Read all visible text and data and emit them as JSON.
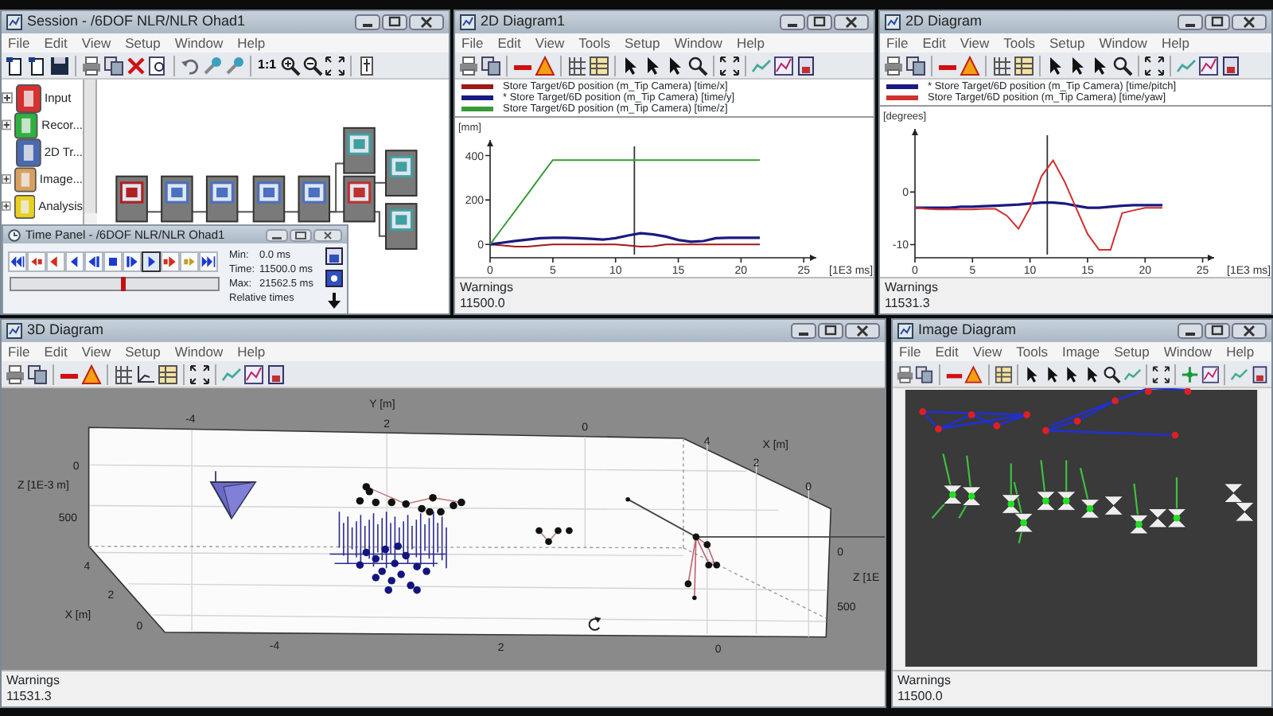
{
  "session_window": {
    "title": "Session - /6DOF NLR/NLR Ohad1",
    "menu": [
      "File",
      "Edit",
      "View",
      "Setup",
      "Window",
      "Help"
    ],
    "zoom_label": "1:1",
    "tree": [
      {
        "label": "Input",
        "kind": "group",
        "expanded": false
      },
      {
        "label": "Recor...",
        "kind": "group",
        "expanded": false
      },
      {
        "label": "2D Tr...",
        "kind": "leaf"
      },
      {
        "label": "Image...",
        "kind": "group",
        "expanded": false
      },
      {
        "label": "Analysis",
        "kind": "group",
        "expanded": false
      }
    ],
    "time_panel": {
      "title": "Time Panel - /6DOF NLR/NLR Ohad1",
      "play_active": true,
      "min_label": "Min:",
      "min": "0.0 ms",
      "time_label": "Time:",
      "time": "11500.0 ms",
      "max_label": "Max:",
      "max": "21562.5 ms",
      "mode": "Relative times",
      "level": 0.53
    }
  },
  "diagram_1": {
    "title": "2D Diagram1",
    "menu": [
      "File",
      "Edit",
      "View",
      "Tools",
      "Setup",
      "Window",
      "Help"
    ],
    "chart_data": {
      "type": "line",
      "xlabel": "[1E3 ms]",
      "ylabel": "[mm]",
      "x": [
        0,
        1,
        2,
        3,
        4,
        5,
        6,
        7,
        8,
        9,
        10,
        11,
        12,
        13,
        14,
        15,
        16,
        17,
        18,
        19,
        20,
        21,
        21.5
      ],
      "series": [
        {
          "name": "Store Target/6D position (m_Tip Camera) [time/x]",
          "color": "#a01818",
          "values": [
            0,
            -5,
            -10,
            -10,
            -5,
            0,
            0,
            0,
            0,
            0,
            0,
            -5,
            -10,
            -8,
            0,
            0,
            0,
            0,
            0,
            0,
            0,
            0,
            0
          ]
        },
        {
          "name": "* Store Target/6D position (m_Tip Camera) [time/y]",
          "color": "#1a1a80",
          "values": [
            0,
            8,
            16,
            22,
            28,
            30,
            30,
            28,
            25,
            22,
            28,
            40,
            50,
            45,
            35,
            20,
            12,
            15,
            28,
            30,
            30,
            30,
            30
          ]
        },
        {
          "name": "Store Target/6D position (m_Tip Camera) [time/z]",
          "color": "#3a9a3a",
          "values": [
            0,
            76,
            152,
            228,
            304,
            380,
            380,
            380,
            380,
            380,
            380,
            380,
            380,
            380,
            380,
            380,
            380,
            380,
            380,
            380,
            380,
            380,
            380
          ]
        }
      ],
      "xlim": [
        0,
        26
      ],
      "ylim": [
        -60,
        470
      ],
      "xticks": [
        0,
        5,
        10,
        15,
        20,
        25
      ],
      "yticks": [
        0,
        200,
        400
      ],
      "ref_lines": [
        {
          "axis": "x",
          "value": 11.5
        }
      ]
    },
    "status": {
      "label": "Warnings",
      "value": "11500.0"
    }
  },
  "diagram_2": {
    "title": "2D Diagram",
    "menu": [
      "File",
      "Edit",
      "View",
      "Tools",
      "Setup",
      "Window",
      "Help"
    ],
    "chart_data": {
      "type": "line",
      "xlabel": "[1E3 ms]",
      "ylabel": "[degrees]",
      "x": [
        0,
        1,
        2,
        3,
        4,
        5,
        6,
        7,
        8,
        9,
        10,
        11,
        12,
        13,
        14,
        15,
        16,
        17,
        18,
        19,
        20,
        21,
        21.5
      ],
      "series": [
        {
          "name": "* Store Target/6D position (m_Tip Camera) [time/pitch]",
          "color": "#1a1a80",
          "values": [
            -3,
            -3,
            -3,
            -3,
            -2.8,
            -2.8,
            -2.7,
            -2.6,
            -2.5,
            -2.4,
            -2.2,
            -2,
            -2,
            -2.2,
            -2.6,
            -3,
            -3,
            -2.8,
            -2.6,
            -2.5,
            -2.5,
            -2.5,
            -2.5
          ]
        },
        {
          "name": "Store Target/6D position (m_Tip Camera) [time/yaw]",
          "color": "#d03030",
          "values": [
            -3,
            -3.2,
            -3.3,
            -3.3,
            -3.3,
            -3.3,
            -3.2,
            -3.2,
            -4.5,
            -7,
            -3,
            3,
            6,
            2,
            -3,
            -8,
            -11,
            -11,
            -4,
            -3.5,
            -3,
            -3,
            -3
          ]
        }
      ],
      "xlim": [
        0,
        26
      ],
      "ylim": [
        -12.5,
        12
      ],
      "xticks": [
        0,
        5,
        10,
        15,
        20,
        25
      ],
      "yticks": [
        -10,
        0
      ],
      "ref_lines": [
        {
          "axis": "x",
          "value": 11.5
        }
      ]
    },
    "status": {
      "label": "Warnings",
      "value": "11531.3"
    }
  },
  "diagram_3d": {
    "title": "3D Diagram",
    "menu": [
      "File",
      "Edit",
      "View",
      "Setup",
      "Window",
      "Help"
    ],
    "axis_labels": [
      "Y [m]",
      "-4",
      "2",
      "0",
      "4",
      "X [m]",
      "2",
      "0",
      "Z [1E-3 m]",
      "0",
      "500",
      "4",
      "2",
      "X [m]",
      "0",
      "-4",
      "2",
      "0",
      "0",
      "Z [1E",
      "500"
    ],
    "status": {
      "label": "Warnings",
      "value": "11531.3"
    }
  },
  "image_diagram": {
    "title": "Image Diagram",
    "menu": [
      "File",
      "Edit",
      "View",
      "Tools",
      "Image",
      "Setup",
      "Window",
      "Help"
    ],
    "status": {
      "label": "Warnings",
      "value": "11500.0"
    }
  }
}
